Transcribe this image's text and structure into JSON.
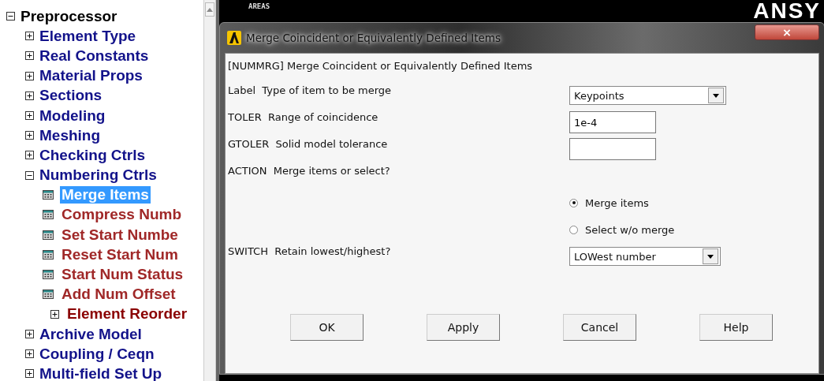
{
  "tree": {
    "label": "Preprocessor",
    "expanded": true,
    "children": [
      {
        "label": "Element Type",
        "expanded": false
      },
      {
        "label": "Real Constants",
        "expanded": false
      },
      {
        "label": "Material Props",
        "expanded": false
      },
      {
        "label": "Sections",
        "expanded": false
      },
      {
        "label": "Modeling",
        "expanded": false
      },
      {
        "label": "Meshing",
        "expanded": false
      },
      {
        "label": "Checking Ctrls",
        "expanded": false
      },
      {
        "label": "Numbering Ctrls",
        "expanded": true,
        "children": [
          {
            "label": "Merge Items",
            "kind": "command",
            "selected": true
          },
          {
            "label": "Compress Numb",
            "kind": "command",
            "selected": false
          },
          {
            "label": "Set Start Numbe",
            "kind": "command",
            "selected": false
          },
          {
            "label": "Reset Start Num",
            "kind": "command",
            "selected": false
          },
          {
            "label": "Start Num Status",
            "kind": "command",
            "selected": false
          },
          {
            "label": "Add Num Offset",
            "kind": "command",
            "selected": false
          },
          {
            "label": "Element Reorder",
            "kind": "folder",
            "expanded": false
          }
        ]
      },
      {
        "label": "Archive Model",
        "expanded": false
      },
      {
        "label": "Coupling / Ceqn",
        "expanded": false
      },
      {
        "label": "Multi-field Set Up",
        "expanded": false
      }
    ]
  },
  "graphics": {
    "label": "AREAS",
    "logo": "ANSY"
  },
  "dialog": {
    "title": "Merge Coincident or Equivalently Defined Items",
    "heading": "[NUMMRG]  Merge Coincident or Equivalently Defined Items",
    "fields": [
      {
        "kind": "dropdown",
        "name": "Label",
        "prompt": "Type of item to be merge",
        "value": "Keypoints"
      },
      {
        "kind": "text",
        "name": "TOLER",
        "prompt": "Range of coincidence",
        "value": "1e-4"
      },
      {
        "kind": "text",
        "name": "GTOLER",
        "prompt": "Solid model tolerance"
      },
      {
        "kind": "radio",
        "name": "ACTION",
        "prompt": "Merge items or select?",
        "options": [
          {
            "label": "Merge items",
            "selected": true
          },
          {
            "label": "Select w/o merge",
            "selected": false
          }
        ]
      },
      {
        "kind": "dropdown",
        "name": "SWITCH",
        "prompt": "Retain lowest/highest?",
        "value": "LOWest number"
      }
    ],
    "buttons": [
      "OK",
      "Apply",
      "Cancel",
      "Help"
    ]
  }
}
